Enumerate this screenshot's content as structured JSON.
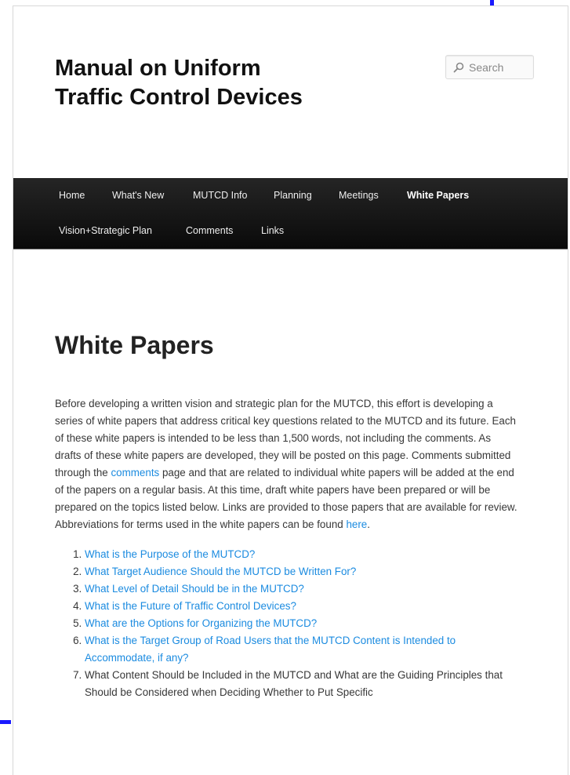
{
  "site": {
    "title": "Manual on Uniform Traffic Control Devices"
  },
  "search": {
    "placeholder": "Search"
  },
  "nav": {
    "items": [
      {
        "label": "Home"
      },
      {
        "label": "What's New"
      },
      {
        "label": "MUTCD Info"
      },
      {
        "label": "Planning"
      },
      {
        "label": "Meetings"
      },
      {
        "label": "White Papers",
        "current": true
      },
      {
        "label": "Vision+Strategic Plan"
      },
      {
        "label": "Comments"
      },
      {
        "label": "Links"
      }
    ]
  },
  "page": {
    "title": "White Papers",
    "intro": {
      "part1": "Before developing a written vision and strategic plan for the MUTCD, this effort is developing a series of white papers that address critical key questions related to the MUTCD and its future.  Each of these white papers is intended to be less than 1,500 words, not including the comments.  As drafts of these white papers are developed, they will be posted on this page.  Comments submitted through the ",
      "comments_link": "comments",
      "part2": " page and that are related to individual white papers will be added at the end of the papers on a regular basis.  At this time, draft white papers have been prepared or will be prepared on the topics listed below.  Links are provided to those papers that are available for review.  Abbreviations for terms used in the white papers can be found ",
      "here_link": "here",
      "part3": "."
    },
    "papers": [
      {
        "text": "What is the Purpose of the MUTCD?",
        "linked": true
      },
      {
        "text": "What Target Audience Should the MUTCD be Written For?",
        "linked": true
      },
      {
        "text": "What Level of Detail Should be in the MUTCD?",
        "linked": true
      },
      {
        "text": "What is the Future of Traffic Control Devices?",
        "linked": true
      },
      {
        "text": "What are the Options for Organizing the MUTCD?",
        "linked": true
      },
      {
        "text": "What is the Target Group of Road Users that the MUTCD Content is Intended to Accommodate, if any?",
        "linked": true
      },
      {
        "text": "What Content Should be Included in the MUTCD and What are the Guiding Principles that Should be Considered when Deciding Whether to Put Specific",
        "linked": false
      }
    ]
  },
  "colors": {
    "link": "#1b8be0",
    "nav_bg": "#1a1a1a",
    "edge_marker": "#1a1aff"
  }
}
